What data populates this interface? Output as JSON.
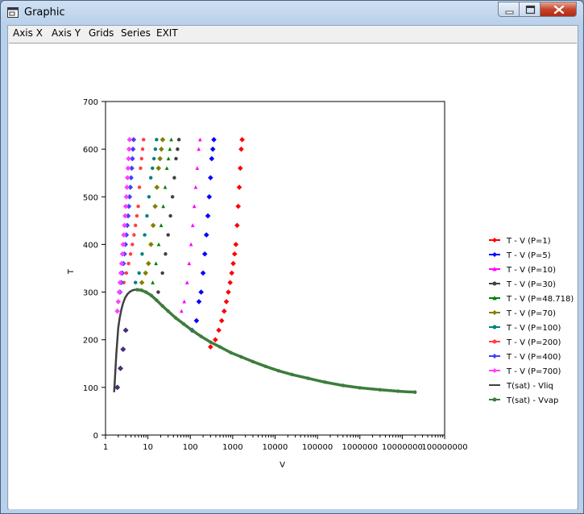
{
  "window": {
    "title": "Graphic",
    "icon": "app-window-icon"
  },
  "window_controls": {
    "minimize": "minimize-icon",
    "maximize": "maximize-icon",
    "close": "close-icon"
  },
  "menu": [
    "Axis X",
    "Axis Y",
    "Grids",
    "Series",
    "EXIT"
  ],
  "chart_data": {
    "type": "scatter",
    "xlabel": "V",
    "ylabel": "T",
    "xscale": "log",
    "xlim": [
      1,
      100000000
    ],
    "ylim": [
      0,
      700
    ],
    "xticks": [
      "1",
      "10",
      "100",
      "1000",
      "10000",
      "100000",
      "1000000",
      "10000000",
      "100000000"
    ],
    "yticks": [
      "0",
      "100",
      "200",
      "300",
      "400",
      "500",
      "600",
      "700"
    ],
    "grid": false,
    "legend_position": "right",
    "series": [
      {
        "name": "T - V (P=1)",
        "color": "#ff0000",
        "marker": "diamond",
        "x": [
          1.9,
          2.25,
          2.6,
          3.0,
          300,
          390,
          470,
          550,
          630,
          710,
          790,
          870,
          950,
          1030,
          1110,
          1190,
          1270,
          1350,
          1430,
          1510,
          1590,
          1670
        ],
        "y": [
          100,
          140,
          180,
          220,
          185,
          200,
          220,
          240,
          260,
          280,
          300,
          320,
          340,
          360,
          380,
          400,
          440,
          480,
          520,
          560,
          600,
          620
        ]
      },
      {
        "name": "T - V (P=5)",
        "color": "#0000ff",
        "marker": "diamond",
        "x": [
          1.9,
          2.25,
          2.6,
          3.0,
          110,
          140,
          160,
          180,
          200,
          220,
          240,
          260,
          280,
          300,
          320,
          340,
          360
        ],
        "y": [
          100,
          140,
          180,
          220,
          220,
          240,
          280,
          300,
          340,
          380,
          420,
          460,
          500,
          540,
          580,
          600,
          620
        ]
      },
      {
        "name": "T - V (P=10)",
        "color": "#ff00ff",
        "marker": "triangle",
        "x": [
          1.9,
          2.25,
          2.6,
          3.0,
          62,
          72,
          84,
          94,
          104,
          114,
          124,
          134,
          146,
          158,
          170
        ],
        "y": [
          100,
          140,
          180,
          220,
          260,
          280,
          320,
          360,
          400,
          440,
          480,
          520,
          560,
          600,
          620
        ]
      },
      {
        "name": "T - V (P=30)",
        "color": "#404040",
        "marker": "circle",
        "x": [
          1.9,
          2.25,
          2.6,
          3.0,
          17.5,
          22,
          26,
          30,
          34,
          38,
          42,
          46,
          50,
          54
        ],
        "y": [
          100,
          140,
          180,
          220,
          300,
          340,
          380,
          420,
          460,
          500,
          540,
          580,
          600,
          620
        ]
      },
      {
        "name": "T - V (P=48.718)",
        "color": "#008000",
        "marker": "triangle",
        "x": [
          13,
          15.5,
          18,
          20.5,
          23,
          25.5,
          28,
          30.5,
          33,
          35.5
        ],
        "y": [
          320,
          360,
          400,
          440,
          480,
          520,
          560,
          580,
          600,
          620
        ]
      },
      {
        "name": "T - V (P=70)",
        "color": "#808000",
        "marker": "diamond",
        "x": [
          7.2,
          8.8,
          10.3,
          11.8,
          13.3,
          14.8,
          16.3,
          17.8,
          19.3,
          20.8,
          22.3
        ],
        "y": [
          320,
          340,
          360,
          400,
          440,
          480,
          520,
          560,
          580,
          600,
          620
        ]
      },
      {
        "name": "T - V (P=100)",
        "color": "#008080",
        "marker": "circle",
        "x": [
          5.1,
          6.2,
          7.3,
          8.4,
          9.5,
          10.6,
          11.7,
          12.8,
          13.9,
          15.0,
          16.0
        ],
        "y": [
          320,
          340,
          380,
          420,
          460,
          500,
          540,
          560,
          580,
          600,
          620
        ]
      },
      {
        "name": "T - V (P=200)",
        "color": "#ff4040",
        "marker": "circle",
        "x": [
          2.7,
          3.1,
          3.5,
          3.9,
          4.3,
          4.7,
          5.1,
          5.5,
          5.9,
          6.3,
          6.7,
          7.1,
          7.5,
          7.9
        ],
        "y": [
          320,
          340,
          360,
          380,
          400,
          420,
          440,
          460,
          480,
          520,
          560,
          580,
          600,
          620
        ]
      },
      {
        "name": "T - V (P=400)",
        "color": "#4040ff",
        "marker": "diamond",
        "x": [
          2.2,
          2.35,
          2.5,
          2.65,
          2.8,
          2.95,
          3.1,
          3.25,
          3.4,
          3.55,
          3.7,
          3.85,
          4.0,
          4.15,
          4.3,
          4.45,
          4.6
        ],
        "y": [
          300,
          320,
          340,
          360,
          380,
          400,
          420,
          440,
          460,
          480,
          500,
          520,
          540,
          560,
          580,
          600,
          620
        ]
      },
      {
        "name": "T - V (P=700)",
        "color": "#ff40ff",
        "marker": "diamond",
        "x": [
          1.9,
          2.0,
          2.1,
          2.2,
          2.3,
          2.4,
          2.5,
          2.6,
          2.7,
          2.8,
          2.9,
          3.0,
          3.1,
          3.2,
          3.3,
          3.4,
          3.5,
          3.6,
          3.7
        ],
        "y": [
          260,
          280,
          300,
          320,
          340,
          360,
          380,
          400,
          420,
          440,
          460,
          480,
          500,
          520,
          540,
          560,
          580,
          600,
          620
        ]
      },
      {
        "name": "T(sat) - Vliq",
        "color": "#404040",
        "marker": "line",
        "x": [
          1.6,
          1.65,
          1.72,
          1.8,
          1.9,
          2.0,
          2.15,
          2.35,
          2.6,
          2.9,
          3.3,
          3.8,
          4.4,
          5.0,
          5.6
        ],
        "y": [
          90,
          110,
          140,
          170,
          200,
          225,
          245,
          262,
          277,
          288,
          296,
          301,
          304,
          305,
          305
        ]
      },
      {
        "name": "T(sat) - Vvap",
        "color": "#3c7d3c",
        "marker": "circle",
        "x": [
          5.6,
          7,
          9,
          12,
          16,
          22,
          30,
          45,
          70,
          110,
          180,
          300,
          500,
          900,
          1600,
          3000,
          6000,
          12000,
          25000,
          60000,
          150000,
          400000,
          1000000,
          3000000,
          8000000,
          20000000
        ],
        "y": [
          305,
          304,
          300,
          293,
          283,
          271,
          260,
          246,
          233,
          220,
          207,
          195,
          185,
          173,
          164,
          154,
          144,
          135,
          127,
          119,
          111,
          104,
          99,
          95,
          92,
          90
        ]
      }
    ]
  }
}
